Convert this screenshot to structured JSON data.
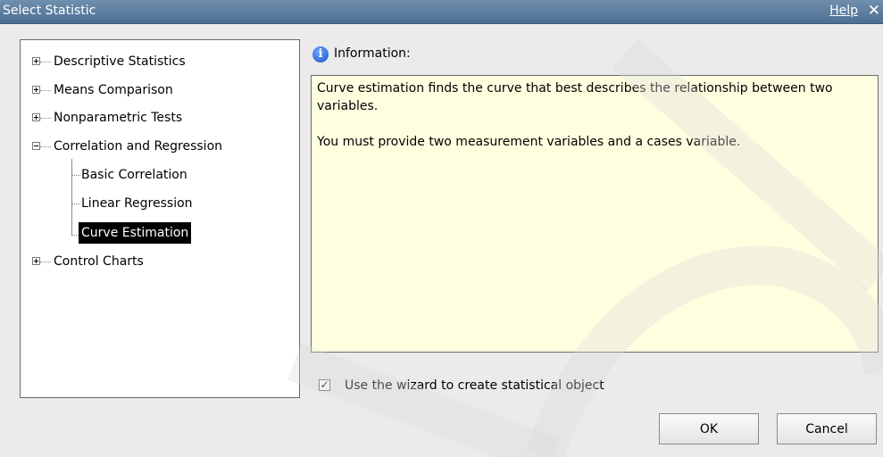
{
  "dialog": {
    "title": "Select Statistic",
    "help_label": "Help",
    "close_glyph": "✕"
  },
  "tree": {
    "items": [
      {
        "label": "Descriptive Statistics",
        "state": "collapsed"
      },
      {
        "label": "Means Comparison",
        "state": "collapsed"
      },
      {
        "label": "Nonparametric Tests",
        "state": "collapsed"
      },
      {
        "label": "Correlation and Regression",
        "state": "expanded",
        "children": [
          {
            "label": "Basic Correlation"
          },
          {
            "label": "Linear Regression"
          },
          {
            "label": "Curve Estimation",
            "selected": true
          }
        ]
      },
      {
        "label": "Control Charts",
        "state": "collapsed"
      }
    ]
  },
  "information": {
    "icon": "info-icon",
    "icon_glyph": "i",
    "label": "Information:",
    "paragraphs": [
      "Curve estimation finds the curve that best describes the relationship between two variables.",
      "You must provide two measurement variables and a cases variable."
    ]
  },
  "wizard": {
    "checked": true,
    "check_glyph": "✓",
    "label": "Use the wizard to create statistical object"
  },
  "buttons": {
    "ok": "OK",
    "cancel": "Cancel"
  },
  "colors": {
    "titlebar": "#5b7c9e",
    "info_background": "#ffffe0",
    "selection": "#000000"
  }
}
